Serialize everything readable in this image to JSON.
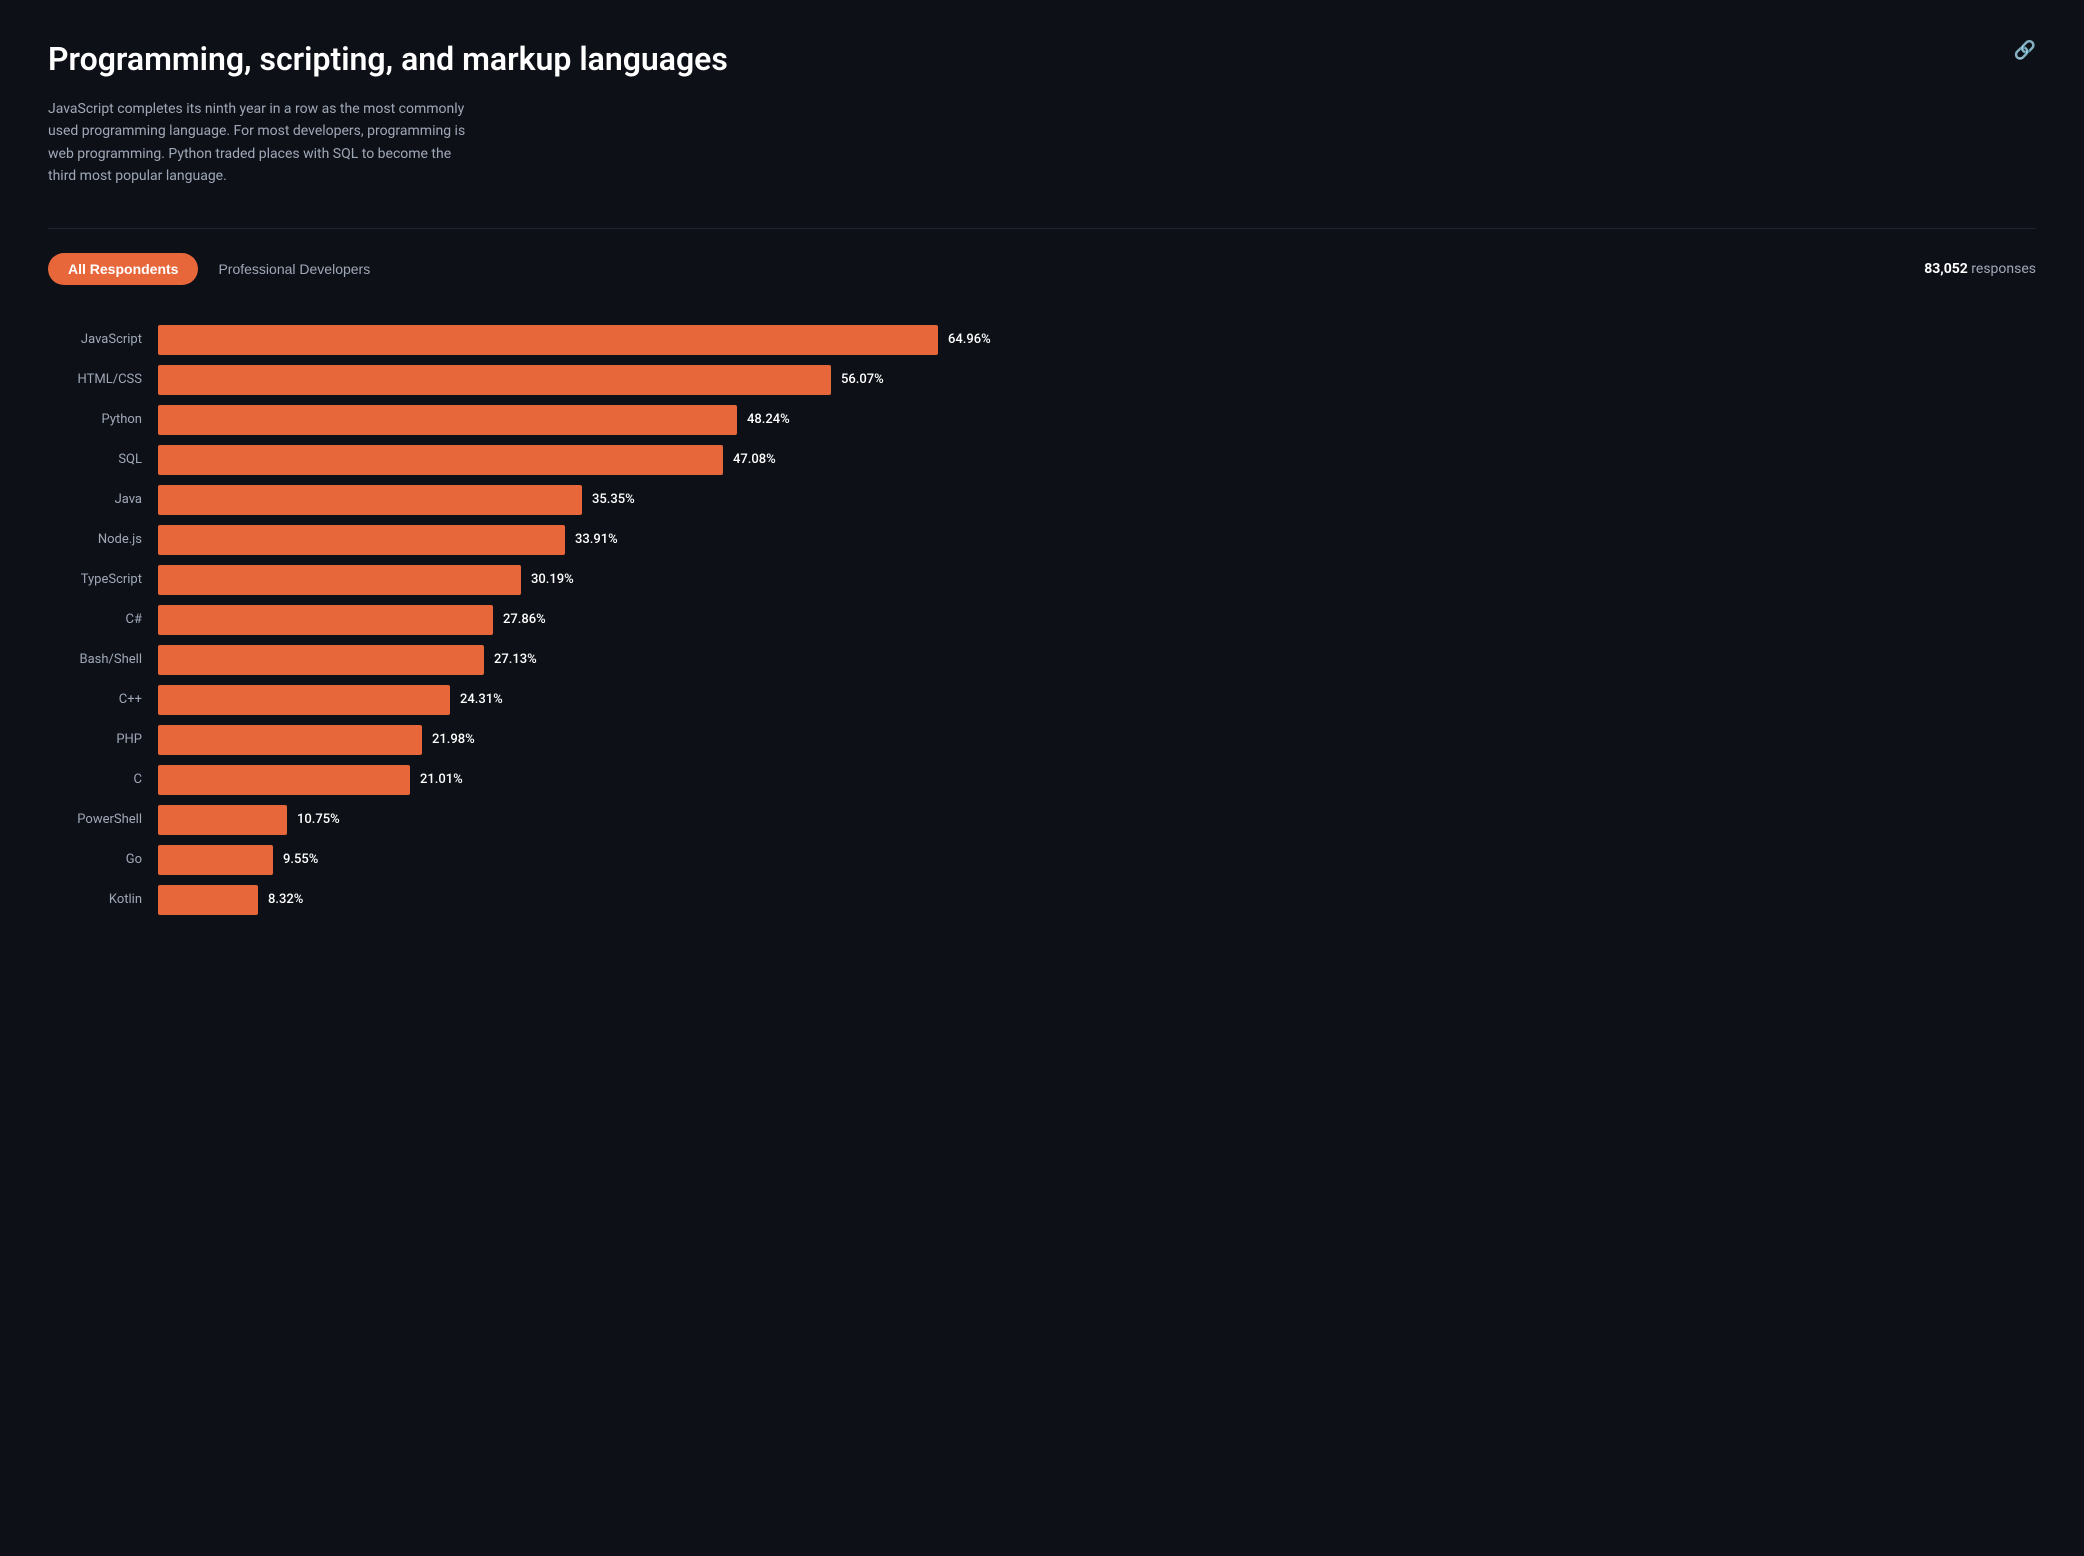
{
  "header": {
    "title": "Programming, scripting, and markup languages",
    "description": "JavaScript completes its ninth year in a row as the most commonly used programming language. For most developers, programming is web programming. Python traded places with SQL to become the third most popular language.",
    "link_icon": "🔗"
  },
  "tabs": {
    "all_respondents_label": "All Respondents",
    "pro_developers_label": "Professional Developers",
    "responses_count": "83,052",
    "responses_label": "responses"
  },
  "chart": {
    "max_pct": 64.96,
    "bars": [
      {
        "label": "JavaScript",
        "pct": 64.96,
        "pct_str": "64.96%"
      },
      {
        "label": "HTML/CSS",
        "pct": 56.07,
        "pct_str": "56.07%"
      },
      {
        "label": "Python",
        "pct": 48.24,
        "pct_str": "48.24%"
      },
      {
        "label": "SQL",
        "pct": 47.08,
        "pct_str": "47.08%"
      },
      {
        "label": "Java",
        "pct": 35.35,
        "pct_str": "35.35%"
      },
      {
        "label": "Node.js",
        "pct": 33.91,
        "pct_str": "33.91%"
      },
      {
        "label": "TypeScript",
        "pct": 30.19,
        "pct_str": "30.19%"
      },
      {
        "label": "C#",
        "pct": 27.86,
        "pct_str": "27.86%"
      },
      {
        "label": "Bash/Shell",
        "pct": 27.13,
        "pct_str": "27.13%"
      },
      {
        "label": "C++",
        "pct": 24.31,
        "pct_str": "24.31%"
      },
      {
        "label": "PHP",
        "pct": 21.98,
        "pct_str": "21.98%"
      },
      {
        "label": "C",
        "pct": 21.01,
        "pct_str": "21.01%"
      },
      {
        "label": "PowerShell",
        "pct": 10.75,
        "pct_str": "10.75%"
      },
      {
        "label": "Go",
        "pct": 9.55,
        "pct_str": "9.55%"
      },
      {
        "label": "Kotlin",
        "pct": 8.32,
        "pct_str": "8.32%"
      }
    ]
  }
}
